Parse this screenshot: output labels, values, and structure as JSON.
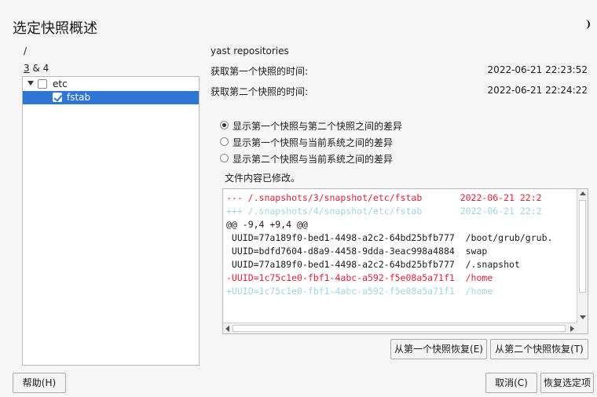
{
  "header": {
    "title": "选定快照概述"
  },
  "left": {
    "path": "/",
    "range_prefix": "3",
    "range_suffix": " & 4",
    "tree": [
      {
        "label": "etc",
        "checked": false
      },
      {
        "label": "fstab",
        "checked": true
      }
    ]
  },
  "right": {
    "description": "yast repositories",
    "first_time_label": "获取第一个快照的时间:",
    "first_time_value": "2022-06-21 22:23:52",
    "second_time_label": "获取第二个快照的时间:",
    "second_time_value": "2022-06-21 22:24:22",
    "radios": [
      {
        "label": "显示第一个快照与第二个快照之间的差异",
        "selected": true
      },
      {
        "label": "显示第一个快照与当前系统之间的差异",
        "selected": false
      },
      {
        "label": "显示第二个快照与当前系统之间的差异",
        "selected": false
      }
    ],
    "modified_text": "文件内容已修改。",
    "diff_lines": [
      {
        "text": "--- /.snapshots/3/snapshot/etc/fstab       2022-06-21 22:2",
        "style": "red"
      },
      {
        "text": "+++ /.snapshots/4/snapshot/etc/fstab       2022-06-21 22:2",
        "style": "cyan"
      },
      {
        "text": "@@ -9,4 +9,4 @@",
        "style": "blk"
      },
      {
        "text": " UUID=77a189f0-bed1-4498-a2c2-64bd25bfb777  /boot/grub/grub.",
        "style": "blk"
      },
      {
        "text": " UUID=bdfd7604-d8a9-4458-9dda-3eac998a4884  swap",
        "style": "blk"
      },
      {
        "text": " UUID=77a189f0-bed1-4498-a2c2-64bd25bfb777  /.snapshot",
        "style": "blk"
      },
      {
        "text": "-UUID=1c75c1e0-fbf1-4abc-a592-f5e08a5a71f1  /home",
        "style": "red"
      },
      {
        "text": "+UUID=1c75c1e0-fbf1-4abc-a592-f5e08a5a71f1  /home",
        "style": "cyan"
      }
    ],
    "restore_first_label": "从第一个快照恢复(E)",
    "restore_second_label": "从第二个快照恢复(T)"
  },
  "footer": {
    "help_label": "帮助(H)",
    "cancel_label": "取消(C)",
    "restore_selected_label": "恢复选定项"
  },
  "colors": {
    "selection": "#2f75d6",
    "diff_removed": "#e0243b",
    "diff_added": "#9fd6e6"
  },
  "icons": {
    "status": "moon-icon"
  }
}
